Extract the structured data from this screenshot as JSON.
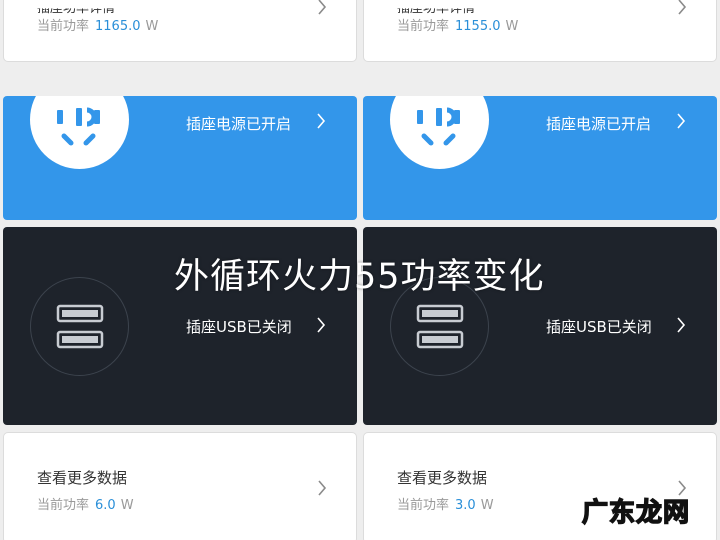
{
  "left": {
    "top_card": {
      "label": "插座功率详情",
      "power_label": "当前功率",
      "power_value": "1165.0",
      "unit": "W"
    },
    "plug_card": {
      "status": "插座电源已开启"
    },
    "usb_card": {
      "status": "插座USB已关闭"
    },
    "more_card": {
      "title": "查看更多数据",
      "power_label": "当前功率",
      "power_value": "6.0",
      "unit": "W"
    }
  },
  "right": {
    "top_card": {
      "label": "插座功率详情",
      "power_label": "当前功率",
      "power_value": "1155.0",
      "unit": "W"
    },
    "plug_card": {
      "status": "插座电源已开启"
    },
    "usb_card": {
      "status": "插座USB已关闭"
    },
    "more_card": {
      "title": "查看更多数据",
      "power_label": "当前功率",
      "power_value": "3.0",
      "unit": "W"
    }
  },
  "overlay_title": "外循环火力55功率变化",
  "watermark": "广东龙网",
  "colors": {
    "accent_blue": "#3396ea",
    "dark_card": "#1e232b",
    "value_blue": "#2a8fd8"
  },
  "icons": {
    "plug": "socket-plug-icon",
    "usb": "usb-port-icon",
    "chevron": "chevron-right-icon"
  }
}
